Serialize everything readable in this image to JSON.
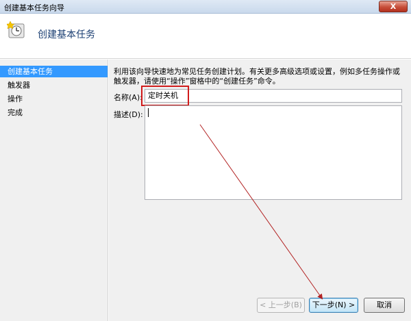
{
  "window": {
    "title": "创建基本任务向导",
    "close_label": "X"
  },
  "header": {
    "title": "创建基本任务",
    "icon": "task-scheduler-icon"
  },
  "nav": {
    "items": [
      {
        "label": "创建基本任务"
      },
      {
        "label": "触发器"
      },
      {
        "label": "操作"
      },
      {
        "label": "完成"
      }
    ]
  },
  "main": {
    "description": "利用该向导快速地为常见任务创建计划。有关更多高级选项或设置，例如多任务操作或触发器，请使用“操作”窗格中的“创建任务”命令。",
    "name_label": "名称(A):",
    "name_value": "定时关机",
    "desc_label": "描述(D):",
    "desc_value": ""
  },
  "buttons": {
    "back": "< 上一步(B)",
    "next": "下一步(N) >",
    "cancel": "取消"
  },
  "colors": {
    "highlight_box": "#d11a1a",
    "arrow": "#b22222",
    "nav_active": "#3399ff"
  }
}
